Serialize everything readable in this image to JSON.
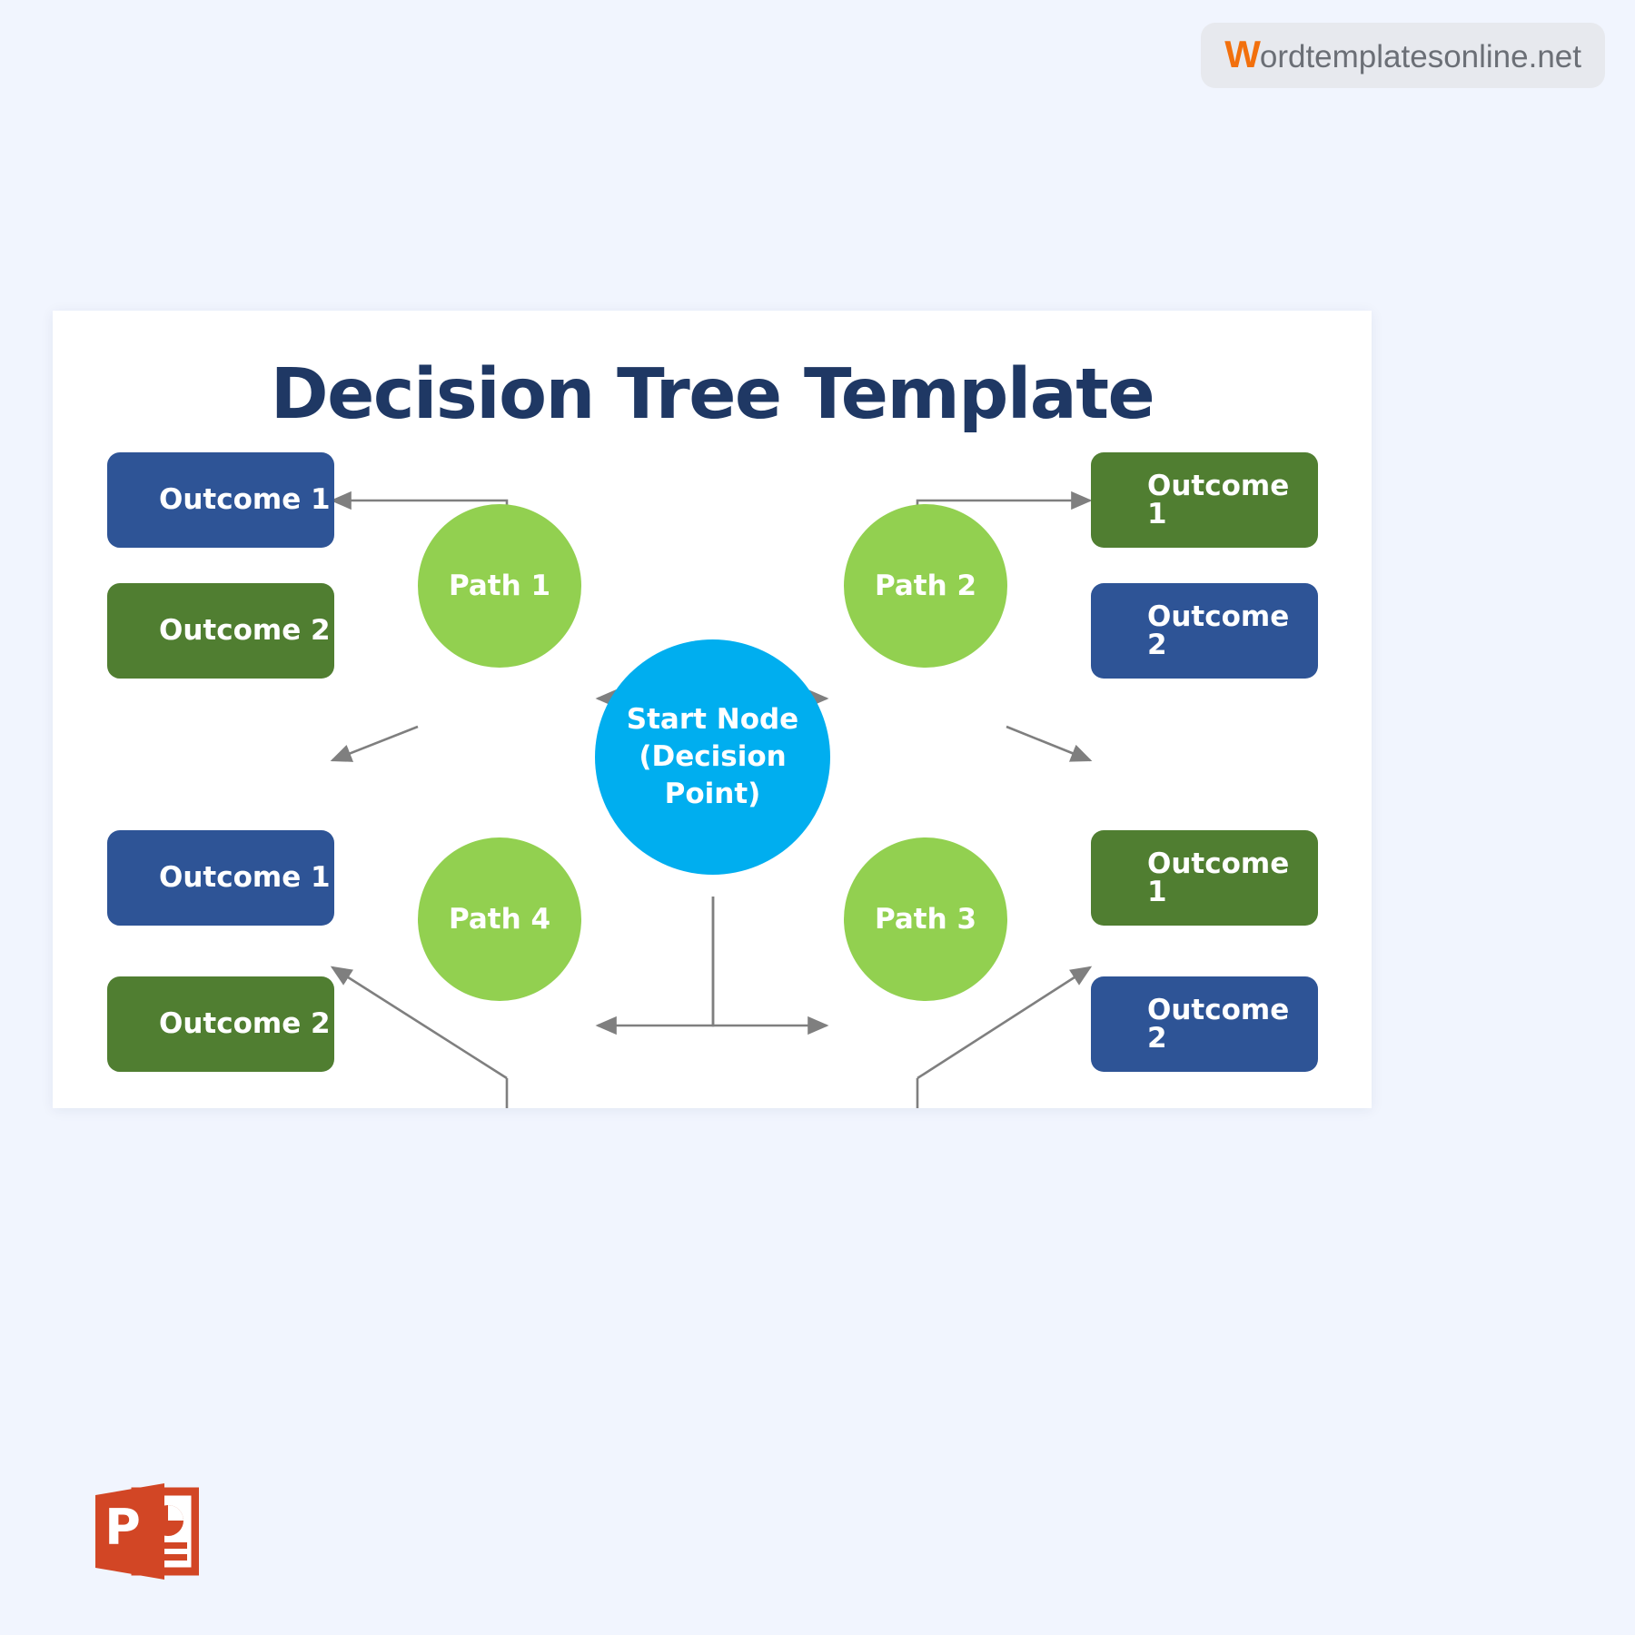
{
  "watermark": {
    "initial": "W",
    "rest": "ordtemplatesonline.net"
  },
  "slide": {
    "title": "Decision Tree Template"
  },
  "chart_data": {
    "type": "diagram",
    "title": "Decision Tree Template",
    "root": {
      "label_line1": "Start Node",
      "label_line2": "(Decision",
      "label_line3": "Point)",
      "color": "#00aeef"
    },
    "branches": [
      {
        "label": "Path 1",
        "color": "#92d050",
        "position": "top-left",
        "outcomes": [
          {
            "label": "Outcome 1",
            "color": "#2e5496"
          },
          {
            "label": "Outcome 2",
            "color": "#507e31"
          }
        ]
      },
      {
        "label": "Path 2",
        "color": "#92d050",
        "position": "top-right",
        "outcomes": [
          {
            "label": "Outcome 1",
            "color": "#507e31"
          },
          {
            "label": "Outcome 2",
            "color": "#2e5496"
          }
        ]
      },
      {
        "label": "Path 3",
        "color": "#92d050",
        "position": "bottom-right",
        "outcomes": [
          {
            "label": "Outcome 1",
            "color": "#507e31"
          },
          {
            "label": "Outcome 2",
            "color": "#2e5496"
          }
        ]
      },
      {
        "label": "Path 4",
        "color": "#92d050",
        "position": "bottom-left",
        "outcomes": [
          {
            "label": "Outcome 1",
            "color": "#2e5496"
          },
          {
            "label": "Outcome 2",
            "color": "#507e31"
          }
        ]
      }
    ],
    "connector_color": "#7f7f7f",
    "background": "#ffffff",
    "page_background": "#f1f5fe"
  },
  "nodes": {
    "start": {
      "line1": "Start Node",
      "line2": "(Decision",
      "line3": "Point)"
    },
    "path1": "Path 1",
    "path2": "Path 2",
    "path3": "Path 3",
    "path4": "Path 4"
  },
  "outcomes": {
    "tl1": "Outcome 1",
    "tl2": "Outcome 2",
    "tr1": "Outcome 1",
    "tr2": "Outcome 2",
    "bl1": "Outcome 1",
    "bl2": "Outcome 2",
    "br1": "Outcome 1",
    "br2": "Outcome 2"
  },
  "footer": {
    "file_type_icon": "powerpoint-icon",
    "icon_letter": "P"
  }
}
